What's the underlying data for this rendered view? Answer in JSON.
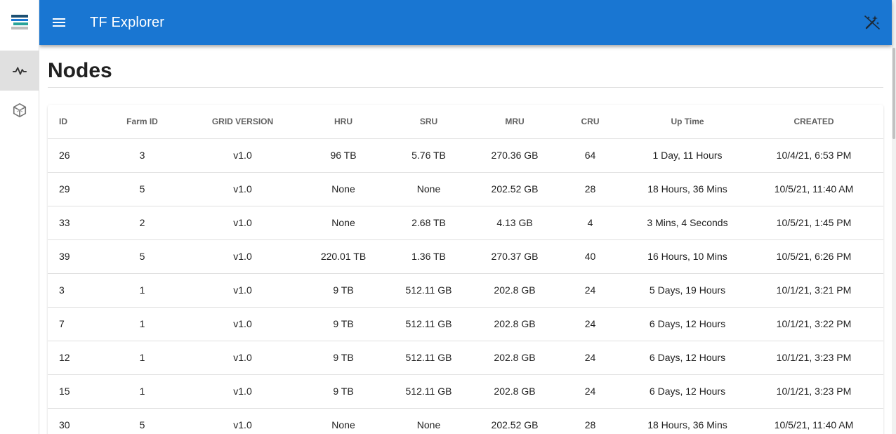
{
  "app": {
    "title": "TF Explorer"
  },
  "sidebar": {
    "items": [
      {
        "icon": "pulse-icon",
        "active": true
      },
      {
        "icon": "cube-icon",
        "active": false
      }
    ]
  },
  "page": {
    "title": "Nodes"
  },
  "table": {
    "headers": [
      "ID",
      "Farm ID",
      "GRID VERSION",
      "HRU",
      "SRU",
      "MRU",
      "CRU",
      "Up Time",
      "CREATED"
    ],
    "rows": [
      [
        "26",
        "3",
        "v1.0",
        "96 TB",
        "5.76 TB",
        "270.36 GB",
        "64",
        "1 Day, 11 Hours",
        "10/4/21, 6:53 PM"
      ],
      [
        "29",
        "5",
        "v1.0",
        "None",
        "None",
        "202.52 GB",
        "28",
        "18 Hours, 36 Mins",
        "10/5/21, 11:40 AM"
      ],
      [
        "33",
        "2",
        "v1.0",
        "None",
        "2.68 TB",
        "4.13 GB",
        "4",
        "3 Mins, 4 Seconds",
        "10/5/21, 1:45 PM"
      ],
      [
        "39",
        "5",
        "v1.0",
        "220.01 TB",
        "1.36 TB",
        "270.37 GB",
        "40",
        "16 Hours, 10 Mins",
        "10/5/21, 6:26 PM"
      ],
      [
        "3",
        "1",
        "v1.0",
        "9 TB",
        "512.11 GB",
        "202.8 GB",
        "24",
        "5 Days, 19 Hours",
        "10/1/21, 3:21 PM"
      ],
      [
        "7",
        "1",
        "v1.0",
        "9 TB",
        "512.11 GB",
        "202.8 GB",
        "24",
        "6 Days, 12 Hours",
        "10/1/21, 3:22 PM"
      ],
      [
        "12",
        "1",
        "v1.0",
        "9 TB",
        "512.11 GB",
        "202.8 GB",
        "24",
        "6 Days, 12 Hours",
        "10/1/21, 3:23 PM"
      ],
      [
        "15",
        "1",
        "v1.0",
        "9 TB",
        "512.11 GB",
        "202.8 GB",
        "24",
        "6 Days, 12 Hours",
        "10/1/21, 3:23 PM"
      ],
      [
        "30",
        "5",
        "v1.0",
        "None",
        "None",
        "202.52 GB",
        "28",
        "18 Hours, 36 Mins",
        "10/5/21, 11:40 AM"
      ]
    ]
  },
  "colors": {
    "appbar": "#1976d2",
    "active_nav": "#e0e0e0"
  }
}
